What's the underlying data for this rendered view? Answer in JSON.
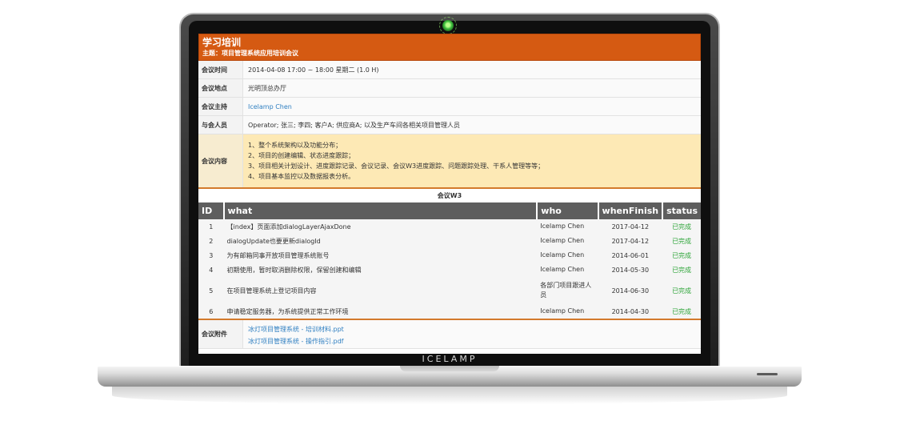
{
  "device": {
    "brand": "ICELAMP"
  },
  "header": {
    "title": "学习培训",
    "subtitle": "主题：项目管理系统应用培训会议"
  },
  "meeting": {
    "time_label": "会议时间",
    "time_value": "2014-04-08 17:00 ~ 18:00  星期二 (1.0 H)",
    "place_label": "会议地点",
    "place_value": "光明顶总办厅",
    "host_label": "会议主持",
    "host_value": "Icelamp Chen",
    "attendees_label": "与会人员",
    "attendees_value": "Operator; 张三; 李四; 客户A; 供应商A; 以及生产车间各相关项目管理人员",
    "content_label": "会议内容",
    "content_lines": [
      "1、整个系统架构以及功能分布；",
      "2、项目的创建编辑、状态进度跟踪；",
      "3、项目相关计划设计、进度跟踪记录、会议记录、会议W3进度跟踪、问题跟踪处理、干系人管理等等；",
      "4、项目基本监控以及数据报表分析。"
    ]
  },
  "w3": {
    "title": "会议W3",
    "columns": [
      "ID",
      "what",
      "who",
      "whenFinish",
      "status"
    ],
    "rows": [
      {
        "id": "1",
        "what": "【index】页面添加dialogLayerAjaxDone",
        "who": "Icelamp Chen",
        "when": "2017-04-12",
        "status": "已完成"
      },
      {
        "id": "2",
        "what": "dialogUpdate也要更新dialogId",
        "who": "Icelamp Chen",
        "when": "2017-04-12",
        "status": "已完成"
      },
      {
        "id": "3",
        "what": "为有邮箱同事开放项目管理系统账号",
        "who": "Icelamp Chen",
        "when": "2014-06-01",
        "status": "已完成"
      },
      {
        "id": "4",
        "what": "初期使用，暂时取消删除权限，保留创建和编辑",
        "who": "Icelamp Chen",
        "when": "2014-05-30",
        "status": "已完成"
      },
      {
        "id": "5",
        "what": "在项目管理系统上登记项目内容",
        "who": "各部门项目跟进人员",
        "when": "2014-06-30",
        "status": "已完成"
      },
      {
        "id": "6",
        "what": "申请稳定服务器，为系统提供正常工作环境",
        "who": "Icelamp Chen",
        "when": "2014-04-30",
        "status": "已完成"
      }
    ]
  },
  "attachments": {
    "label": "会议附件",
    "files": [
      "冰灯项目管理系统 - 培训材料.ppt",
      "冰灯项目管理系统 - 操作指引.pdf"
    ]
  },
  "colors": {
    "header_bg": "#d55a12",
    "content_bg": "#fde9b5",
    "table_header_bg": "#5e5e5e",
    "status_done": "#2fa53a",
    "link": "#2f7fc1"
  }
}
